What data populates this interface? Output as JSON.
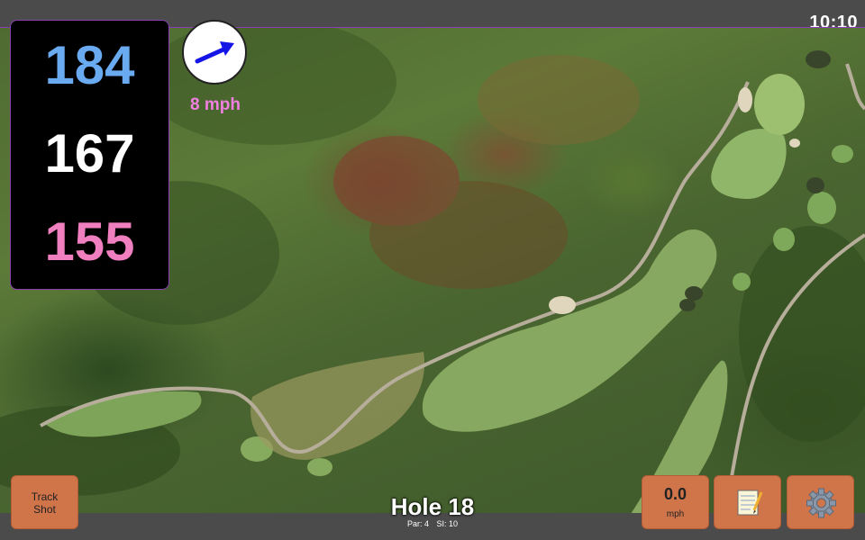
{
  "status": {
    "time": "10:10"
  },
  "distances": {
    "back": "184",
    "middle": "167",
    "front": "155"
  },
  "wind": {
    "speed_label": "8 mph",
    "arrow_color": "#1515e6"
  },
  "hole": {
    "title": "Hole 18",
    "par_label": "Par: 4",
    "si_label": "SI: 10"
  },
  "buttons": {
    "track_shot_line1": "Track",
    "track_shot_line2": "Shot",
    "speed_value": "0.0",
    "speed_unit": "mph",
    "notes_icon": "notepad-icon",
    "settings_icon": "gear-icon"
  },
  "colors": {
    "back": "#6aaaf0",
    "middle": "#ffffff",
    "front": "#f07fc0",
    "button": "#d0744a",
    "wind_text": "#f07fe0",
    "panel_border": "#8a3fb0"
  }
}
